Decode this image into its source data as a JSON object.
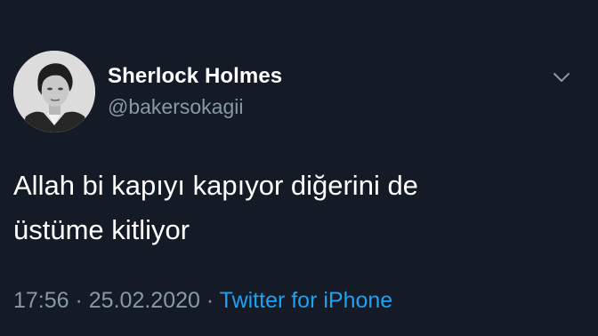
{
  "tweet": {
    "author": {
      "display_name": "Sherlock Holmes",
      "handle": "@bakersokagii",
      "avatar_icon": "user-avatar"
    },
    "text_lines": [
      "Allah bi kapıyı kapıyor diğerini de",
      "üstüme kitliyor"
    ],
    "time": "17:56",
    "separator": " · ",
    "date": "25.02.2020",
    "source": "Twitter for iPhone",
    "menu_icon": "chevron-down-icon"
  },
  "colors": {
    "background": "#141b26",
    "primary_text": "#ffffff",
    "secondary_text": "#8899a6",
    "link": "#1da1f2"
  }
}
